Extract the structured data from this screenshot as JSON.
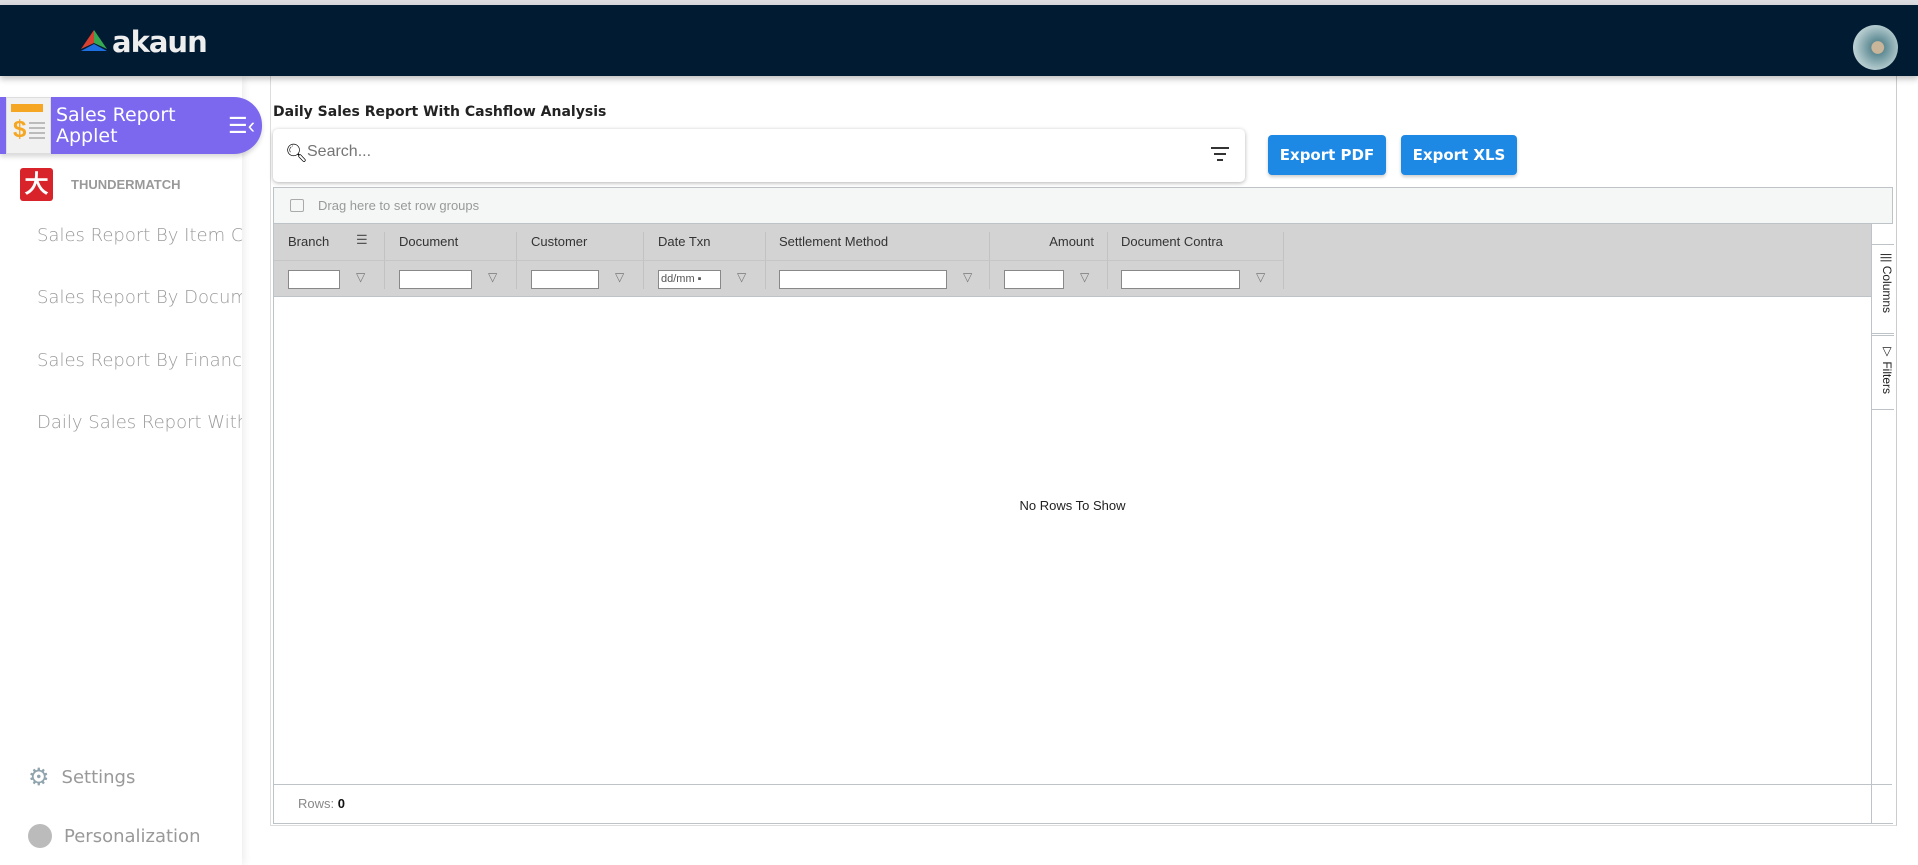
{
  "nav": {
    "logo": "akaun"
  },
  "sidebar": {
    "active_applet": "Sales Report Applet",
    "group": "THUNDERMATCH",
    "items": [
      {
        "label": "Sales Report By Item Code"
      },
      {
        "label": "Sales Report By Document"
      },
      {
        "label": "Sales Report By Finance Category"
      },
      {
        "label": "Daily Sales Report With Cashflow Analysis"
      }
    ],
    "settings": "Settings",
    "personalization": "Personalization"
  },
  "main": {
    "title": "Daily Sales Report With Cashflow Analysis",
    "search_placeholder": "Search...",
    "export_pdf": "Export PDF",
    "export_xls": "Export XLS"
  },
  "grid": {
    "group_panel": "Drag here to set row groups",
    "columns": [
      "Branch",
      "Document",
      "Customer",
      "Date Txn",
      "Settlement Method",
      "Amount",
      "Document Contra"
    ],
    "date_placeholder": "dd/mm",
    "side_columns": "Columns",
    "side_filters": "Filters",
    "empty": "No Rows To Show",
    "rows_label": "Rows:",
    "rows_count": "0"
  },
  "colors": {
    "nav": "#011b33",
    "accent": "#7b68ee",
    "button": "#1e88e5"
  }
}
